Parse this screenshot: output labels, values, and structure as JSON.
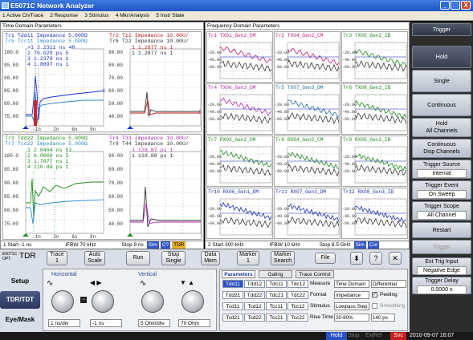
{
  "app": {
    "title": "E5071C Network Analyzer",
    "min": "_",
    "max": "□",
    "close": "X"
  },
  "menu": [
    "1 Active Ch/Trace",
    "2 Response",
    "3 Stimulus",
    "4 Mkr/Analysis",
    "5 Instr State"
  ],
  "time_domain": {
    "title": "Time Domain Parameters",
    "ch1": {
      "hdr1a": "Tr1 Tdd11 Impedance 5.000Ω",
      "hdr1b": "Tr5 Tcc11 Impedance 5.000Ω",
      "hdr2a": "Tr2 T11 Impedance 10.00U/",
      "hdr2b": "Tr6 T22 Impedance 10.00U/",
      "markers_left": [
        ">1  3.2311 ns  48",
        "2  70.029 ps  5",
        "3  1.2378 ns  1",
        "4  1.8897 ns  1"
      ],
      "markers_right": [
        "1  1.2877 ns  1",
        "1  1.2877 ns  1"
      ],
      "yticks_left": [
        "100.0",
        "95.00",
        "90.00",
        "85.00",
        "80.00",
        "75.00",
        "70.00"
      ],
      "yticks_right": [
        "90.00",
        "80.00",
        "70.00",
        "60.00",
        "50.00",
        "40.00",
        "30.00"
      ],
      "xticks": [
        "-1n",
        "2n",
        "6n",
        "9n"
      ]
    },
    "ch2": {
      "hdr1a": "Tr3 Tdd22 Impedance 5.000Ω",
      "hdr1b": "Tr7 Tcc22 Impedance 5.000Ω",
      "hdr2a": "Tr4 T33 Impedance 10.00U/",
      "hdr2b": "Tr8 T44 Impedance 10.00U/",
      "markers_left": [
        "1  2.8464 ns  52",
        "2  6.0000 ns  5",
        "3  1.7877 ns  1",
        "4  110.88 ps  1"
      ],
      "markers_right": [
        "1  128.87 ps  1",
        "1  118.88 ps  1"
      ],
      "yticks_left": [
        "100.0",
        "95.00",
        "90.00",
        "85.00",
        "80.00",
        "75.00",
        "70.00"
      ],
      "yticks_right": [
        "90.00",
        "80.00",
        "70.00",
        "60.00",
        "50.00",
        "40.00",
        "30.00"
      ],
      "xticks": [
        "-1n",
        "2n",
        "6n",
        "9n"
      ]
    },
    "status": {
      "start": "1 Start -1 ns",
      "ifbw": "IFBW 70 kHz",
      "stop": "Stop 9 ns",
      "btn1": "Sim",
      "btn2": "C?",
      "btn3": "TDR"
    }
  },
  "freq_domain": {
    "title": "Frequency Domain Parameters",
    "cells": [
      "Tr1 TX01_Gen2_DM",
      "Tr2 TX04_Gen2_CM",
      "Tr3 TX05_Gen2_IB",
      "Tr4 TX06_Gen3_DM",
      "Tr5 TX07_Gen3_DM",
      "Tr6 TX08_Gen3_IB",
      "Tr7 RX03_Gen2_DM",
      "Tr8 RX04_Gen2_CM",
      "Tr9 RX05_Gen2_IB",
      "Tr10 RX06_Gen1_DM",
      "Tr11 RX07_Gen3_DM",
      "Tr12 RX08_Gen3_IB"
    ],
    "cell_colors": [
      "#c0187c",
      "#c0187c",
      "#1a8a1a",
      "#b02ab0",
      "#1a70a0",
      "#1a8a1a",
      "#1a8a1a",
      "#1a8a1a",
      "#1a8a1a",
      "#1f2fb0",
      "#1f2fb0",
      "#1f2fb0"
    ],
    "yticks": [
      "-20.00",
      "-40.00",
      "-60.00"
    ],
    "status": {
      "start": "2 Start 300 kHz",
      "ifbw": "IFBW 10 kHz",
      "stop": "Stop 8.5 GHz",
      "btn1": "Sim",
      "btn2": "Cor"
    }
  },
  "softkeys": {
    "title": "Trigger",
    "hold": "Hold",
    "single": "Single",
    "continuous": "Continuous",
    "hold_all": "Hold\nAll Channels",
    "cont_disp": "Continuous\nDisp Channels",
    "trig_source": "Trigger Source",
    "trig_source_val": "Internal",
    "trig_event": "Trigger Event",
    "trig_event_val": "On Sweep",
    "trig_scope": "Trigger Scope",
    "trig_scope_val": "All Channel",
    "restart": "Restart",
    "trigger": "Trigger",
    "ext_input": "Ext Trig Input",
    "ext_input_val": "Negative Edge",
    "delay": "Trigger Delay",
    "delay_val": "0.0000 s"
  },
  "bottom": {
    "model": "E5071C",
    "opt": "OPT.",
    "tdr": "TDR",
    "trace": "Trace\n1",
    "autoscale": "Auto\nScale",
    "run": "Run",
    "stop_single": "Stop\nSingle",
    "data_mem": "Data\nMem",
    "marker": "Marker\n1",
    "marker_search": "Marker\nSearch",
    "file": "File",
    "nav": [
      "Setup",
      "TDR/TDT",
      "Eye/Mask"
    ],
    "horizontal": "Horizontal",
    "vertical": "Vertical",
    "h_val1": "1 ns/div",
    "h_val2": "-1 ns",
    "v_val1": "5 Ohm/div",
    "v_val2": "70 Ohm",
    "tabs": [
      "Parameters",
      "Gating",
      "Trace Control"
    ],
    "params": [
      [
        "Tdd11",
        "Tdd12",
        "Tdc11",
        "Tdc12"
      ],
      [
        "Tdd21",
        "Tdd22",
        "Tdc21",
        "Tdc22"
      ],
      [
        "Tcd11",
        "Tcd12",
        "Tcc11",
        "Tcc12"
      ],
      [
        "Tcd21",
        "Tcd22",
        "Tcc21",
        "Tcc22"
      ]
    ],
    "measure": "Measure",
    "measure_val": "Time Domain",
    "measure_val2": "Differential",
    "format": "Format",
    "format_val": "Impedance",
    "peeling": "Peeling",
    "stimulus": "Stimulus",
    "stimulus_val": "Lowpass Step",
    "smoothing": "Smoothing",
    "rise": "Rise Time",
    "rise_val": "20-80%",
    "rise_val2": "140 ps"
  },
  "status": {
    "hold": "Hold",
    "stop": "Stop",
    "extref": "ExtRef",
    "svc": "Svc",
    "datetime": "2010-09-07 16:07"
  }
}
